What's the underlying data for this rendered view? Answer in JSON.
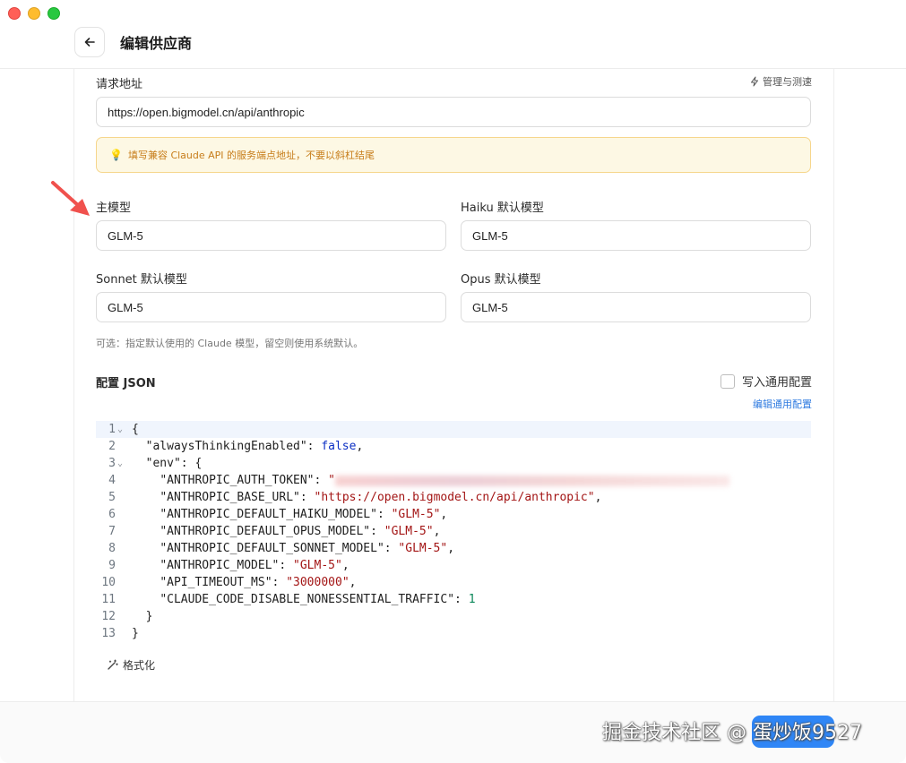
{
  "header": {
    "title": "编辑供应商"
  },
  "endpoint": {
    "label": "请求地址",
    "manage_label": "管理与测速",
    "value": "https://open.bigmodel.cn/api/anthropic",
    "tip": "填写兼容 Claude API 的服务端点地址，不要以斜杠结尾"
  },
  "models": {
    "main": {
      "label": "主模型",
      "value": "GLM-5"
    },
    "haiku": {
      "label": "Haiku 默认模型",
      "value": "GLM-5"
    },
    "sonnet": {
      "label": "Sonnet 默认模型",
      "value": "GLM-5"
    },
    "opus": {
      "label": "Opus 默认模型",
      "value": "GLM-5"
    },
    "hint": "可选：指定默认使用的 Claude 模型，留空则使用系统默认。"
  },
  "config": {
    "title": "配置 JSON",
    "write_common_label": "写入通用配置",
    "write_common_checked": false,
    "edit_common_link": "编辑通用配置",
    "format_label": "格式化"
  },
  "code": {
    "lines": [
      {
        "n": "1",
        "fold": true
      },
      {
        "n": "2",
        "key": "\"alwaysThinkingEnabled\"",
        "value": "false"
      },
      {
        "n": "3",
        "fold": true,
        "key": "\"env\"",
        "value": "{"
      },
      {
        "n": "4",
        "key": "\"ANTHROPIC_AUTH_TOKEN\"",
        "value": "\"",
        "redacted": true
      },
      {
        "n": "5",
        "key": "\"ANTHROPIC_BASE_URL\"",
        "value": "\"https://open.bigmodel.cn/api/anthropic\""
      },
      {
        "n": "6",
        "key": "\"ANTHROPIC_DEFAULT_HAIKU_MODEL\"",
        "value": "\"GLM-5\""
      },
      {
        "n": "7",
        "key": "\"ANTHROPIC_DEFAULT_OPUS_MODEL\"",
        "value": "\"GLM-5\""
      },
      {
        "n": "8",
        "key": "\"ANTHROPIC_DEFAULT_SONNET_MODEL\"",
        "value": "\"GLM-5\""
      },
      {
        "n": "9",
        "key": "\"ANTHROPIC_MODEL\"",
        "value": "\"GLM-5\""
      },
      {
        "n": "10",
        "key": "\"API_TIMEOUT_MS\"",
        "value": "\"3000000\""
      },
      {
        "n": "11",
        "key": "\"CLAUDE_CODE_DISABLE_NONESSENTIAL_TRAFFIC\"",
        "value": "1"
      },
      {
        "n": "12",
        "text": "}"
      },
      {
        "n": "13",
        "text": "}"
      }
    ],
    "open_brace": "{"
  },
  "watermark": "掘金技术社区 @ 蛋炒饭9527",
  "colors": {
    "primary": "#2f86f6",
    "tip_bg": "#fdf8e4",
    "tip_text": "#c77d1a",
    "annotation_arrow": "#f0514d"
  }
}
